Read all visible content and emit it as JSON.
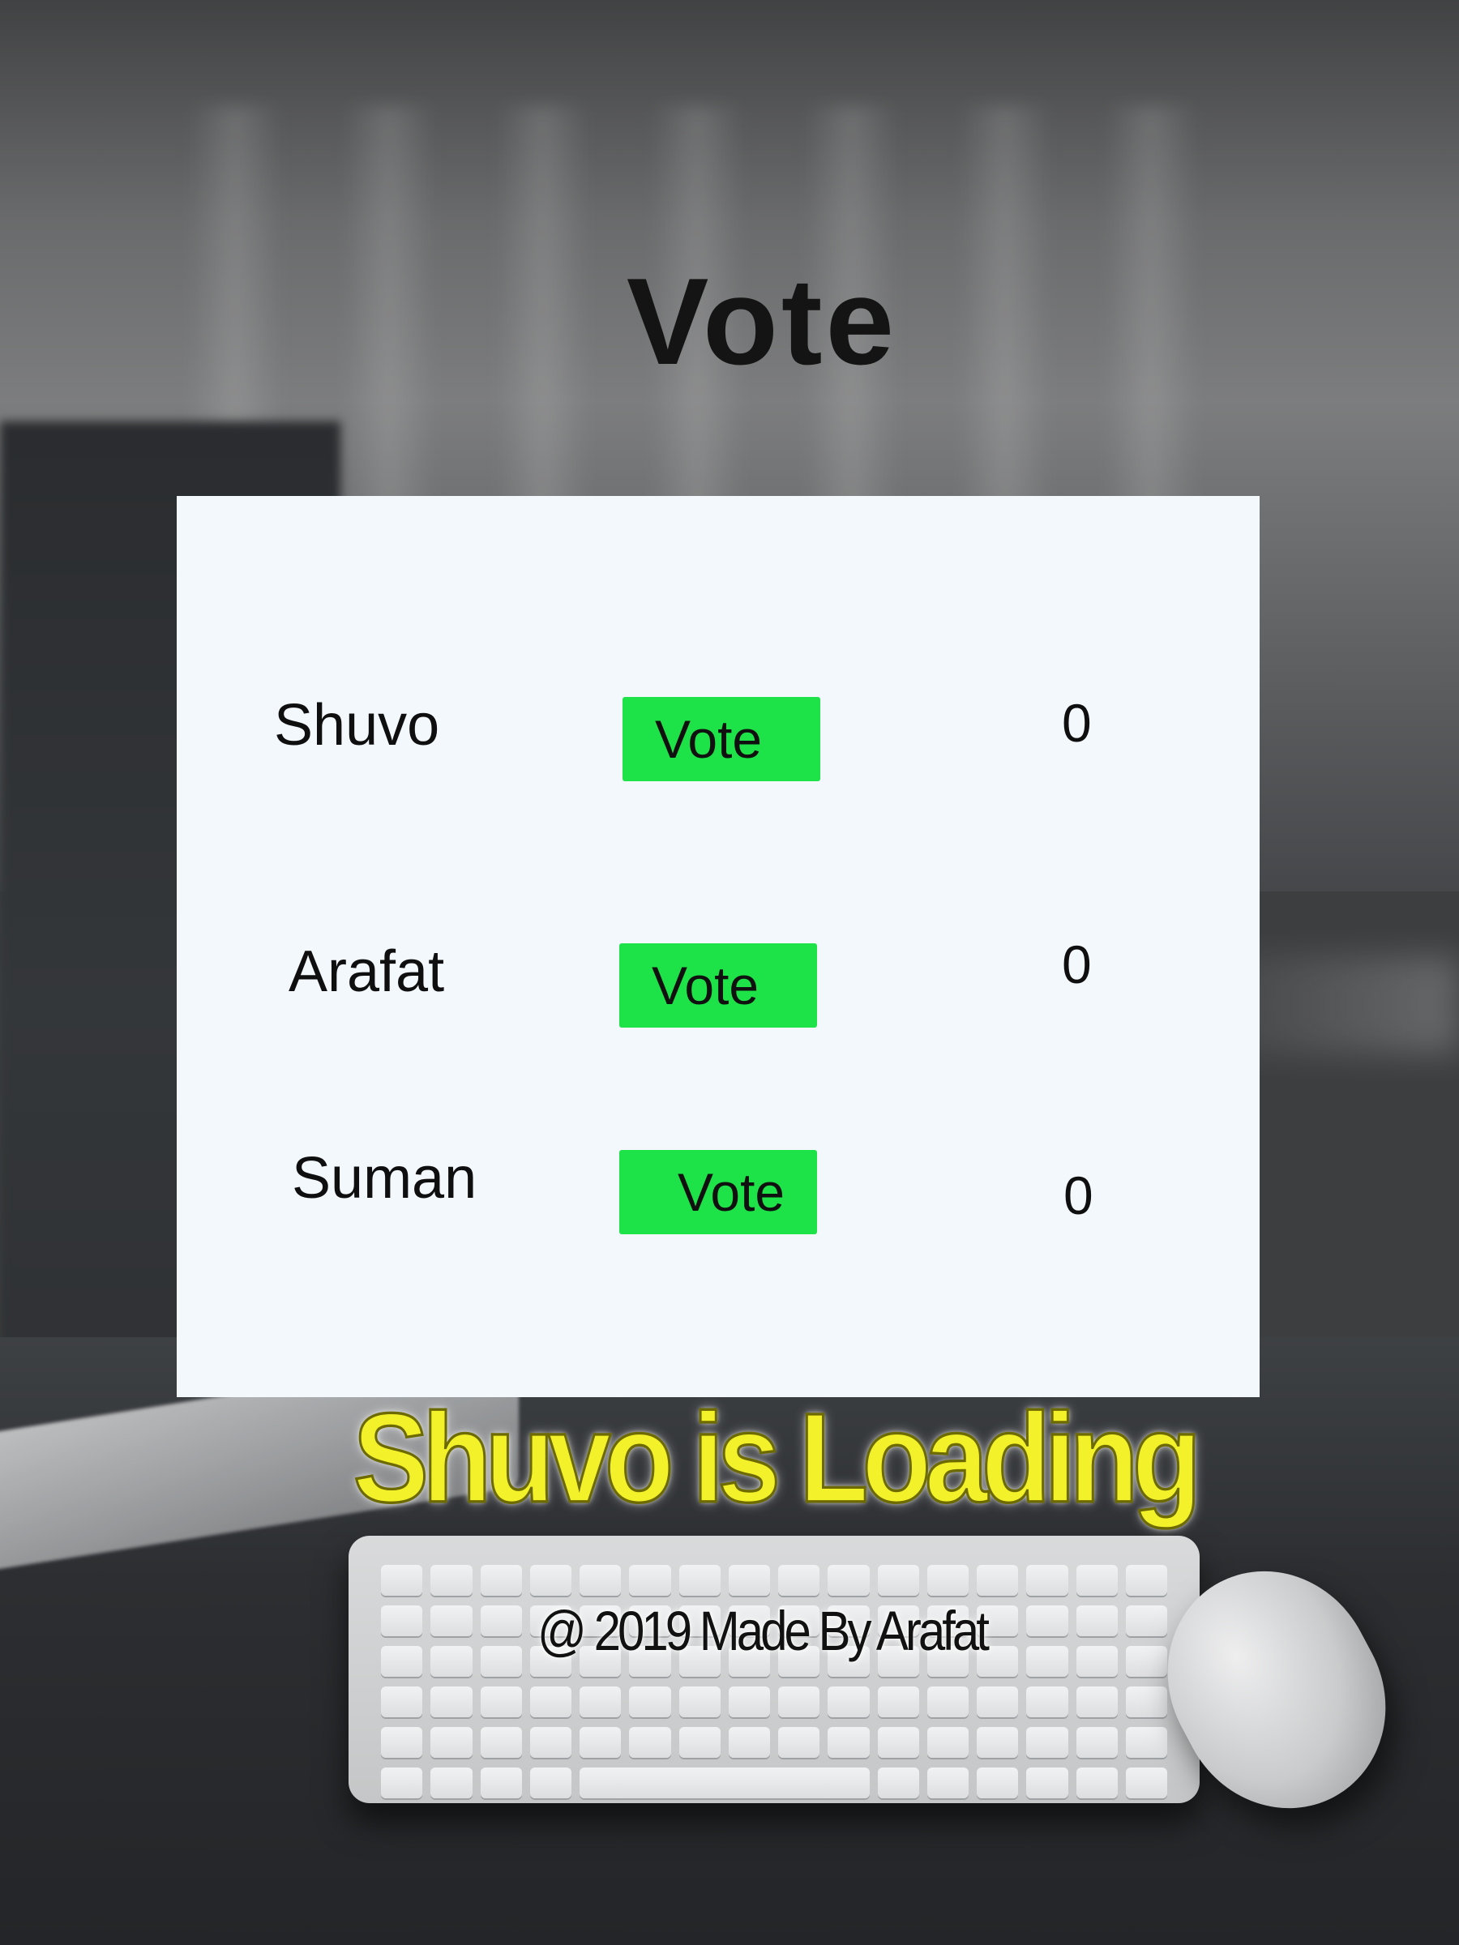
{
  "header": {
    "title": "Vote"
  },
  "candidates": [
    {
      "name": "Shuvo",
      "button_label": "Vote",
      "count": "0"
    },
    {
      "name": "Arafat",
      "button_label": "Vote",
      "count": "0"
    },
    {
      "name": "Suman",
      "button_label": "Vote",
      "count": "0"
    }
  ],
  "footer": {
    "loading": "Shuvo is Loading",
    "credits": "@ 2019 Made By Arafat"
  },
  "colors": {
    "vote_button": "#1de348",
    "card_background": "#f3f8fd",
    "loading_text": "#f3f22a"
  }
}
